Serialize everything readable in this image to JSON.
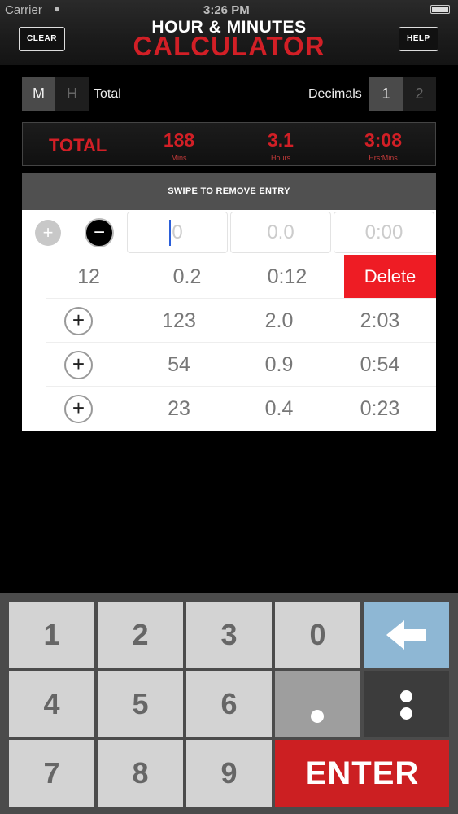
{
  "status": {
    "carrier": "Carrier",
    "time": "3:26 PM"
  },
  "header": {
    "title_line1": "HOUR & MINUTES",
    "title_line2": "CALCULATOR",
    "clear_label": "CLEAR",
    "help_label": "HELP"
  },
  "mode": {
    "m_label": "M",
    "h_label": "H",
    "total_label": "Total",
    "decimals_label": "Decimals",
    "dec1": "1",
    "dec2": "2"
  },
  "totals": {
    "label": "TOTAL",
    "mins": "188",
    "mins_unit": "Mins",
    "hours": "3.1",
    "hours_unit": "Hours",
    "hrsmins": "3:08",
    "hrsmins_unit": "Hrs:Mins"
  },
  "swipe_hint": "SWIPE TO REMOVE ENTRY",
  "entry": {
    "mins_placeholder": "0",
    "hours_placeholder": "0.0",
    "hrsmins_placeholder": "0:00"
  },
  "entries": [
    {
      "mins": "12",
      "hours": "0.2",
      "hrsmins": "0:12",
      "delete_label": "Delete"
    },
    {
      "mins": "123",
      "hours": "2.0",
      "hrsmins": "2:03"
    },
    {
      "mins": "54",
      "hours": "0.9",
      "hrsmins": "0:54"
    },
    {
      "mins": "23",
      "hours": "0.4",
      "hrsmins": "0:23"
    }
  ],
  "keypad": {
    "k1": "1",
    "k2": "2",
    "k3": "3",
    "k0": "0",
    "k4": "4",
    "k5": "5",
    "k6": "6",
    "k7": "7",
    "k8": "8",
    "k9": "9",
    "enter": "ENTER"
  },
  "icons": {
    "back": "arrow-left-icon",
    "add": "plus-circle-icon",
    "remove": "minus-circle-icon"
  }
}
